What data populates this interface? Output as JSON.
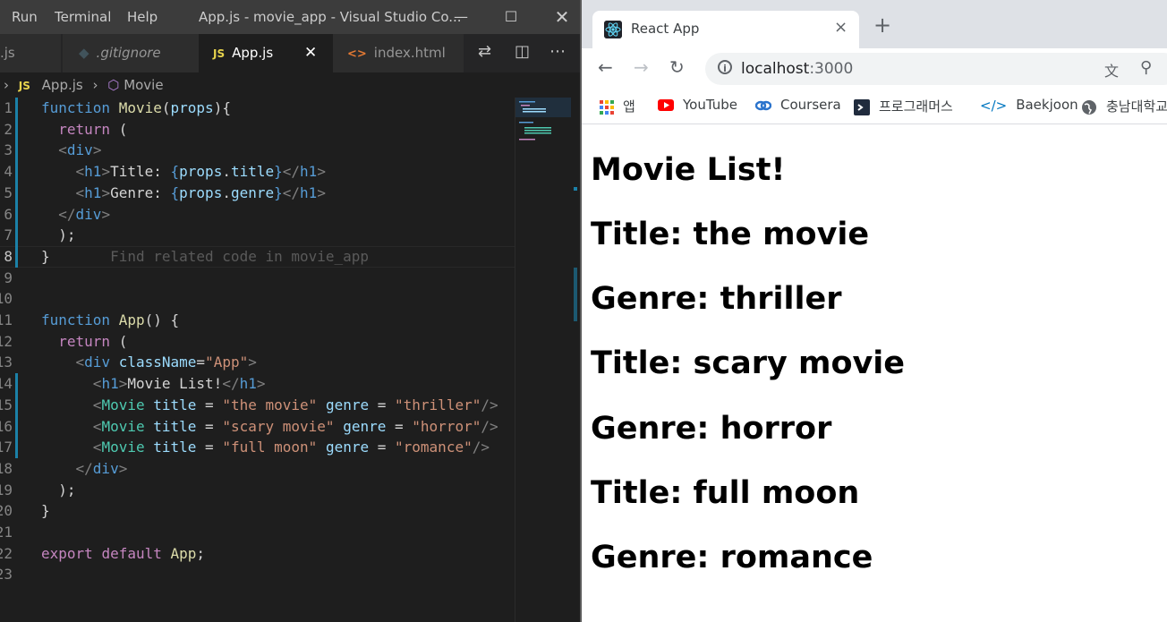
{
  "vscode": {
    "menu": [
      "Run",
      "Terminal",
      "Help"
    ],
    "window_title": "App.js - movie_app - Visual Studio Co...",
    "window_controls": [
      "minimize",
      "maximize",
      "close"
    ],
    "tabs": [
      {
        "label": ".js",
        "icon": "js-file-icon"
      },
      {
        "label": ".gitignore",
        "icon": "git-file-icon"
      },
      {
        "label": "App.js",
        "icon": "js-file-icon",
        "active": true
      },
      {
        "label": "index.html",
        "icon": "html-file-icon"
      }
    ],
    "tab_badges": {
      "js": "JS",
      "html": "<>"
    },
    "tab_actions": [
      "compare-changes-icon",
      "split-editor-icon",
      "more-actions-icon"
    ],
    "breadcrumb": {
      "file": "App.js",
      "symbol": "Movie"
    },
    "code_lines": [
      {
        "n": "1",
        "text": "function Movie(props){"
      },
      {
        "n": "2",
        "text": "  return ("
      },
      {
        "n": "3",
        "text": "  <div>"
      },
      {
        "n": "4",
        "text": "    <h1>Title: {props.title}</h1>"
      },
      {
        "n": "5",
        "text": "    <h1>Genre: {props.genre}</h1>"
      },
      {
        "n": "6",
        "text": "  </div>"
      },
      {
        "n": "7",
        "text": "  );"
      },
      {
        "n": "8",
        "text": "}"
      },
      {
        "n": "9",
        "text": ""
      },
      {
        "n": "10",
        "text": ""
      },
      {
        "n": "11",
        "text": "function App() {"
      },
      {
        "n": "12",
        "text": "  return ("
      },
      {
        "n": "13",
        "text": "    <div className=\"App\">"
      },
      {
        "n": "14",
        "text": "      <h1>Movie List!</h1>"
      },
      {
        "n": "15",
        "text": "      <Movie title = \"the movie\" genre = \"thriller\"/>"
      },
      {
        "n": "16",
        "text": "      <Movie title = \"scary movie\" genre = \"horror\"/>"
      },
      {
        "n": "17",
        "text": "      <Movie title = \"full moon\" genre = \"romance\"/>"
      },
      {
        "n": "18",
        "text": "    </div>"
      },
      {
        "n": "19",
        "text": "  );"
      },
      {
        "n": "20",
        "text": "}"
      },
      {
        "n": "21",
        "text": ""
      },
      {
        "n": "22",
        "text": "export default App;"
      },
      {
        "n": "23",
        "text": ""
      }
    ],
    "inline_hint": "Find related code in movie_app",
    "current_line": 8
  },
  "chrome": {
    "tab_title": "React App",
    "close_tab": "×",
    "new_tab": "+",
    "url_host": "localhost",
    "url_port": ":3000",
    "bookmarks": [
      {
        "label": "앱",
        "icon": "apps-grid-icon"
      },
      {
        "label": "YouTube",
        "icon": "youtube-icon"
      },
      {
        "label": "Coursera",
        "icon": "coursera-icon"
      },
      {
        "label": "프로그래머스",
        "icon": "programmers-icon"
      },
      {
        "label": "Baekjoon",
        "icon": "code-brackets-icon"
      },
      {
        "label": "충남대학교",
        "icon": "globe-icon"
      }
    ],
    "page_headings": [
      "Movie List!",
      "Title: the movie",
      "Genre: thriller",
      "Title: scary movie",
      "Genre: horror",
      "Title: full moon",
      "Genre: romance"
    ]
  }
}
